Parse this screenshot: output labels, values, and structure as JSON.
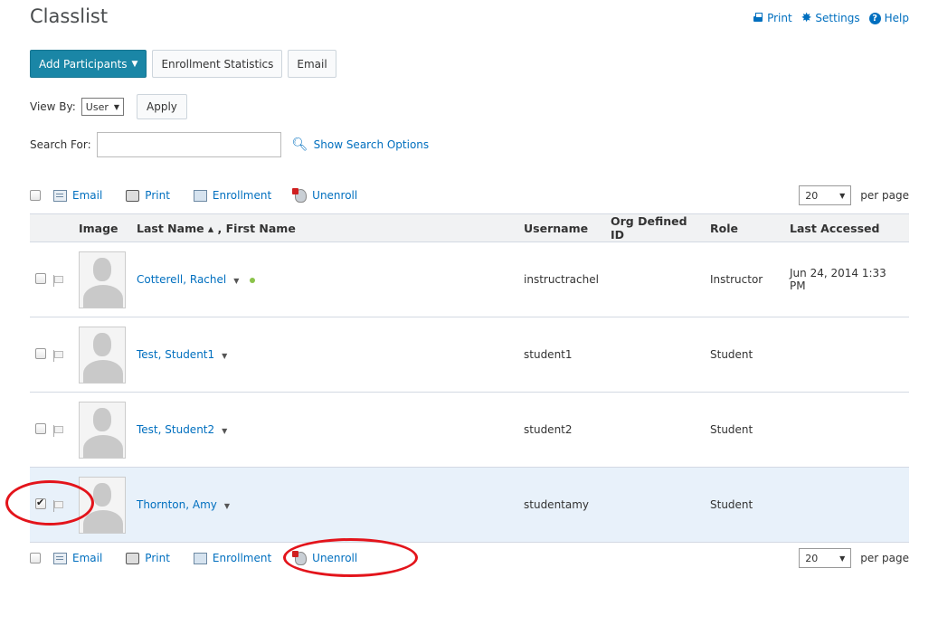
{
  "page": {
    "title": "Classlist"
  },
  "top_links": {
    "print": "Print",
    "settings": "Settings",
    "help": "Help"
  },
  "toolbar": {
    "add_participants": "Add Participants",
    "enrollment_statistics": "Enrollment Statistics",
    "email": "Email"
  },
  "view_by": {
    "label": "View By:",
    "value": "User",
    "apply": "Apply"
  },
  "search": {
    "label": "Search For:",
    "value": "",
    "show_options": "Show Search Options"
  },
  "actions": {
    "email": "Email",
    "print": "Print",
    "enrollment": "Enrollment",
    "unenroll": "Unenroll",
    "per_page_value": "20",
    "per_page_label": "per page"
  },
  "table": {
    "headers": {
      "image": "Image",
      "name": "Last Name ▴ , First Name",
      "username": "Username",
      "org_id": "Org Defined ID",
      "role": "Role",
      "last_accessed": "Last Accessed"
    },
    "rows": [
      {
        "name": "Cotterell, Rachel",
        "username": "instructrachel",
        "org_id": "",
        "role": "Instructor",
        "last_accessed": "Jun 24, 2014 1:33 PM",
        "checked": false,
        "online": true
      },
      {
        "name": "Test, Student1",
        "username": "student1",
        "org_id": "",
        "role": "Student",
        "last_accessed": "",
        "checked": false,
        "online": false
      },
      {
        "name": "Test, Student2",
        "username": "student2",
        "org_id": "",
        "role": "Student",
        "last_accessed": "",
        "checked": false,
        "online": false
      },
      {
        "name": "Thornton, Amy",
        "username": "studentamy",
        "org_id": "",
        "role": "Student",
        "last_accessed": "",
        "checked": true,
        "online": false
      }
    ]
  },
  "colors": {
    "link": "#006fbf",
    "primary_button": "#1a86a6",
    "selected_row": "#e8f1fa",
    "callout": "#e3141b"
  }
}
